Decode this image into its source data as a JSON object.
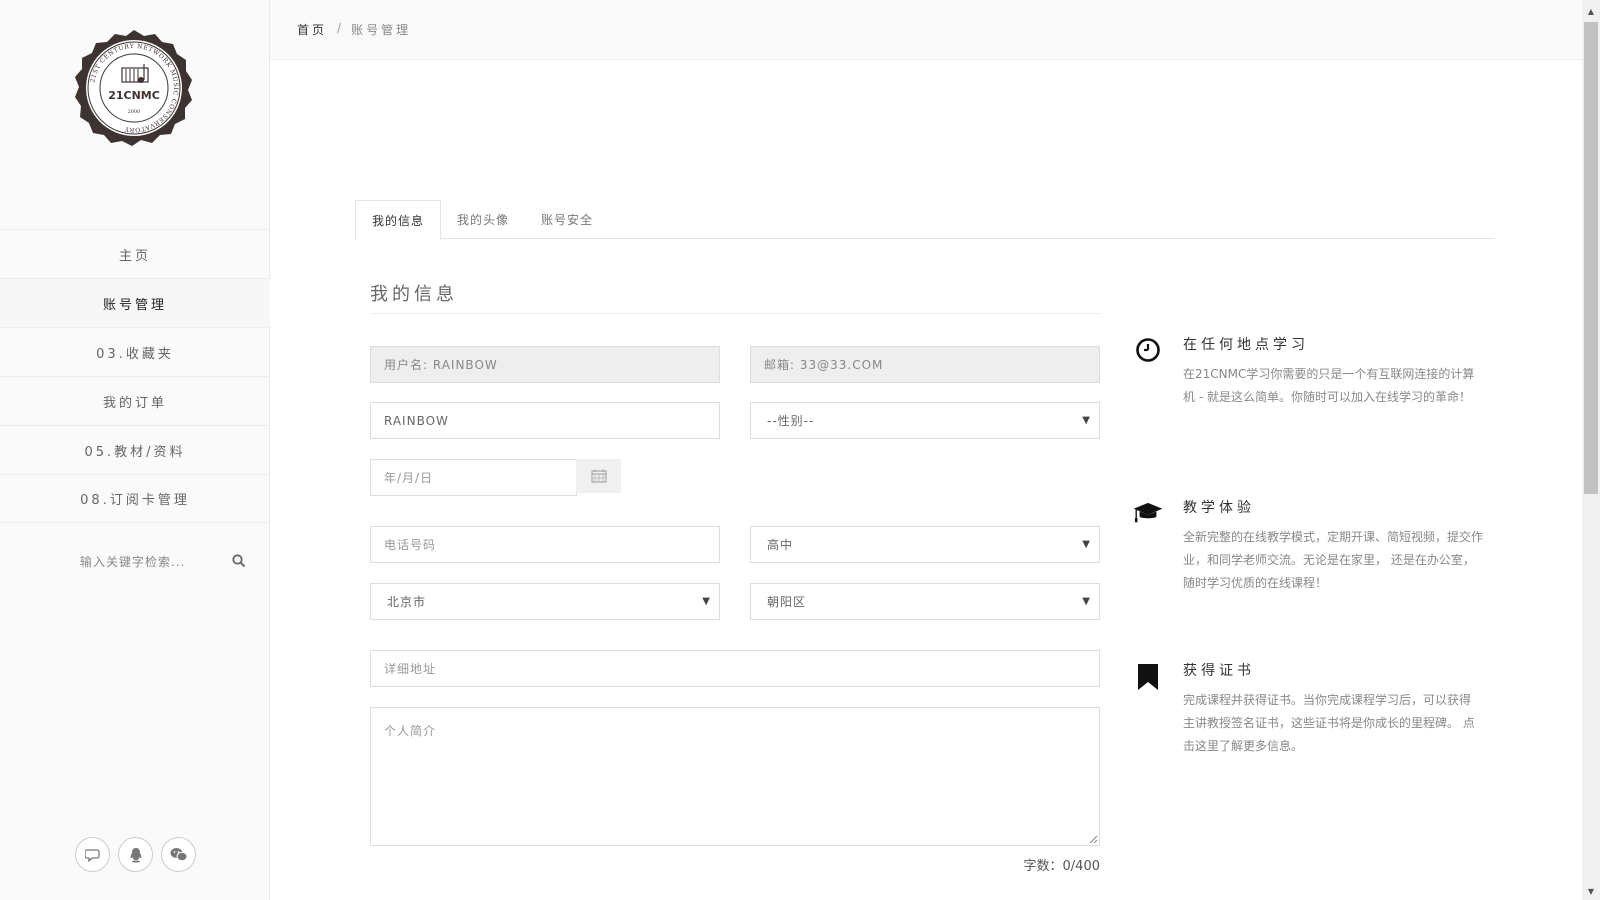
{
  "logo": {
    "brand": "21CNMC",
    "ring_text": "21ST CENTURY NETWORK MUSIC CONSERVATORY",
    "year": "2000"
  },
  "sidebar": {
    "items": [
      {
        "label": "主页"
      },
      {
        "label": "账号管理",
        "active": true
      },
      {
        "label": "03.收藏夹"
      },
      {
        "label": "我的订单"
      },
      {
        "label": "05.教材/资料"
      },
      {
        "label": "08.订阅卡管理"
      }
    ],
    "search_placeholder": "输入关键字检索...",
    "social_icons": [
      "chat-bubble-icon",
      "qq-penguin-icon",
      "wechat-icon"
    ]
  },
  "breadcrumb": {
    "home": "首页",
    "separator": "/",
    "current": "账号管理"
  },
  "tabs": [
    {
      "label": "我的信息",
      "active": true
    },
    {
      "label": "我的头像"
    },
    {
      "label": "账号安全"
    }
  ],
  "form": {
    "title": "我的信息",
    "username": "用户名: RAINBOW",
    "email": "邮箱: 33@33.COM",
    "nickname": "RAINBOW",
    "gender_select": "--性别--",
    "birthday_placeholder": "年/月/日",
    "phone_placeholder": "电话号码",
    "education_select": "高中",
    "province_select": "北京市",
    "district_select": "朝阳区",
    "address_placeholder": "详细地址",
    "bio_placeholder": "个人简介",
    "counter": "字数：0/400"
  },
  "features": [
    {
      "icon": "clock-icon",
      "title": "在任何地点学习",
      "desc": "在21CNMC学习你需要的只是一个有互联网连接的计算机 - 就是这么简单。你随时可以加入在线学习的革命！"
    },
    {
      "icon": "graduation-cap-icon",
      "title": "教学体验",
      "desc": "全新完整的在线教学模式，定期开课、简短视频，提交作业，和同学老师交流。无论是在家里， 还是在办公室，随时学习优质的在线课程！"
    },
    {
      "icon": "bookmark-icon",
      "title": "获得证书",
      "desc": "完成课程并获得证书。当你完成课程学习后，可以获得 主讲教授签名证书，这些证书将是你成长的里程碑。 点击这里了解更多信息。"
    }
  ],
  "colors": {
    "sidebar_bg": "#fafafa",
    "readonly_bg": "#eeeeee",
    "logo_dark": "#3d3331"
  }
}
